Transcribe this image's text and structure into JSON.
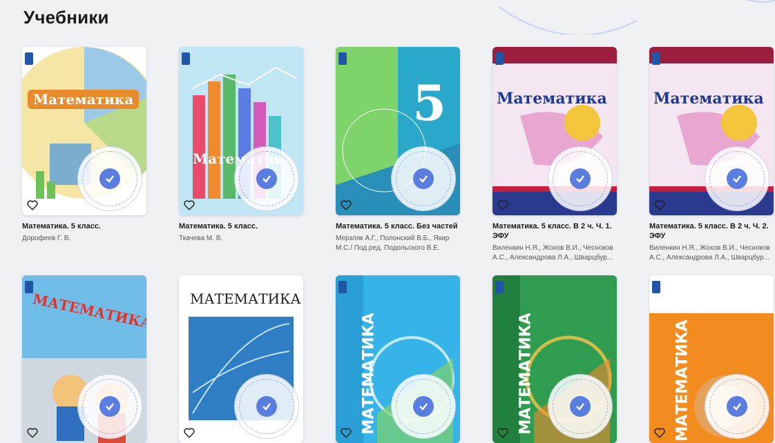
{
  "page": {
    "title": "Учебники"
  },
  "badge_color": "#5a7de0",
  "books": [
    {
      "title": "Математика. 5 класс.",
      "author": "Дорофеев Г. В.",
      "cover_text": "Математика",
      "cover_color": "#f3b94a"
    },
    {
      "title": "Математика. 5 класс.",
      "author": "Ткачева М. В.",
      "cover_text": "Математика",
      "cover_color": "#9ed7ea"
    },
    {
      "title": "Математика. 5 класс. Без частей",
      "author": "Мерзляк А.Г., Полонский В.Б., Якир М.С./ Под ред. Подольского В.Е.",
      "cover_text": "5",
      "cover_color": "#2aa8c9"
    },
    {
      "title": "Математика. 5 класс. В 2 ч. Ч. 1. ЭФУ",
      "author": "Виленкин Н.Я., Жохов В.И., Чесноков А.С., Александрова Л.А., Шварцбур...",
      "cover_text": "Математика",
      "cover_color": "#f4e6f0"
    },
    {
      "title": "Математика. 5 класс. В 2 ч. Ч. 2. ЭФУ",
      "author": "Виленкин Н.Я., Жохов В.И., Чесноков А.С., Александрова Л.А., Шварцбур...",
      "cover_text": "Математика",
      "cover_color": "#f4e6f0"
    },
    {
      "title": "",
      "author": "",
      "cover_text": "МАТЕМАТИКА",
      "cover_color": "#6fbce8"
    },
    {
      "title": "",
      "author": "",
      "cover_text": "МАТЕМАТИКА",
      "cover_color": "#2f7ec4"
    },
    {
      "title": "",
      "author": "",
      "cover_text": "МАТЕМАТИКА",
      "cover_color": "#36b3e8"
    },
    {
      "title": "",
      "author": "",
      "cover_text": "МАТЕМАТИКА",
      "cover_color": "#2f9c4f"
    },
    {
      "title": "",
      "author": "",
      "cover_text": "МАТЕМАТИКА",
      "cover_color": "#f28c1e"
    }
  ]
}
